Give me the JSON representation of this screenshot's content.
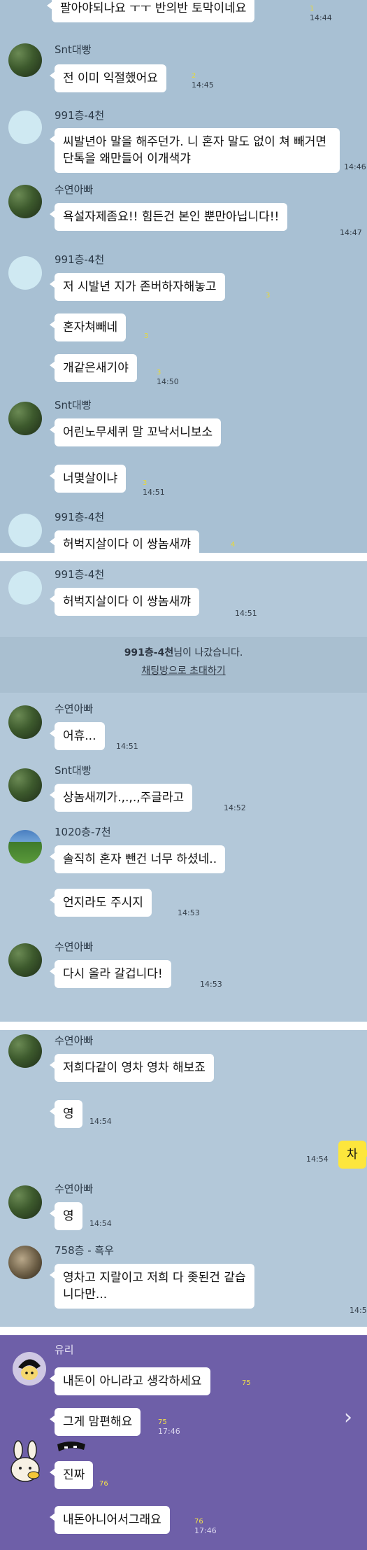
{
  "panel1": {
    "bg": "#a8c0d3",
    "top_message": {
      "text": "팔아야되나요 ㅜㅜ 반의반 토막이네요",
      "count": "1",
      "time": "14:44"
    },
    "groups": [
      {
        "name": "Snt대빵",
        "avatar": "tree",
        "messages": [
          {
            "text": "전 이미 익절했어요",
            "count": "2",
            "time": "14:45"
          }
        ]
      },
      {
        "name": "991층-4천",
        "avatar": "default",
        "messages": [
          {
            "text": "씨발년아 말을 해주던가. 니 혼자 말도 없이 쳐 빼거면 단톡을 왜만들어 이개색갸",
            "count": "",
            "time": "14:46"
          }
        ]
      },
      {
        "name": "수연아빠",
        "avatar": "tree",
        "messages": [
          {
            "text": "욕설자제좀요!! 힘든건 본인 뿐만아닙니다!!",
            "count": "",
            "time": "14:47"
          }
        ]
      },
      {
        "name": "991층-4천",
        "avatar": "default",
        "messages": [
          {
            "text": "저 시발년 지가 존버하자해놓고",
            "count": "3",
            "time": ""
          },
          {
            "text": "혼자쳐빼네",
            "count": "3",
            "time": ""
          },
          {
            "text": "개같은새기야",
            "count": "3",
            "time": "14:50"
          }
        ]
      },
      {
        "name": "Snt대빵",
        "avatar": "tree",
        "messages": [
          {
            "text": "어린노무세퀴 말 꼬낙서니보소",
            "count": "3",
            "time": ""
          },
          {
            "text": "너몇살이냐",
            "count": "3",
            "time": "14:51"
          }
        ]
      },
      {
        "name": "991층-4천",
        "avatar": "default",
        "messages": [
          {
            "text": "허벅지살이다 이 쌍놈새꺄",
            "count": "4",
            "time": ""
          }
        ]
      }
    ]
  },
  "panel2": {
    "bg": "#b3c8d9",
    "first": {
      "name": "991층-4천",
      "text": "허벅지살이다 이 쌍놈새꺄",
      "time": "14:51"
    },
    "system": {
      "who": "991층-4천",
      "rest": "님이 나갔습니다.",
      "link": "채팅방으로 초대하기"
    },
    "groups": [
      {
        "name": "수연아빠",
        "avatar": "tree",
        "messages": [
          {
            "text": "어휴...",
            "time": "14:51"
          }
        ]
      },
      {
        "name": "Snt대빵",
        "avatar": "tree",
        "messages": [
          {
            "text": "상놈새끼가.,.,.,주글라고",
            "time": "14:52"
          }
        ]
      },
      {
        "name": "1020층-7천",
        "avatar": "field",
        "messages": [
          {
            "text": "솔직히 혼자 뺀건 너무 하셨네..",
            "time": ""
          },
          {
            "text": "언지라도 주시지",
            "time": "14:53"
          }
        ]
      },
      {
        "name": "수연아빠",
        "avatar": "tree",
        "messages": [
          {
            "text": "다시 올라 갈겁니다!",
            "time": "14:53"
          }
        ]
      }
    ]
  },
  "panel3": {
    "bg": "#b3c8d9",
    "groups": [
      {
        "name": "수연아빠",
        "avatar": "tree",
        "messages": [
          {
            "text": "저희다같이 영차 영차 해보죠",
            "time": ""
          },
          {
            "text": "영",
            "time": "14:54"
          }
        ]
      }
    ],
    "mine": {
      "text": "차",
      "time": "14:54"
    },
    "groups2": [
      {
        "name": "수연아빠",
        "avatar": "tree",
        "messages": [
          {
            "text": "영",
            "time": "14:54"
          }
        ]
      },
      {
        "name": "758층 - 흑우",
        "avatar": "photo",
        "messages": [
          {
            "text": "영차고 지랄이고 저희 다 좆된건 같습니다만...",
            "time": "14:5"
          }
        ]
      }
    ]
  },
  "panel4": {
    "bg": "#6e5fa8",
    "name": "유리",
    "messages": [
      {
        "text": "내돈이 아니라고 생각하세요",
        "count": "75",
        "time": ""
      },
      {
        "text": "그게 맘편해요",
        "count": "75",
        "time": "17:46"
      },
      {
        "text": "진짜",
        "count": "76",
        "time": ""
      },
      {
        "text": "내돈아니어서그래요",
        "count": "76",
        "time": "17:46"
      }
    ],
    "chevron": "›"
  }
}
